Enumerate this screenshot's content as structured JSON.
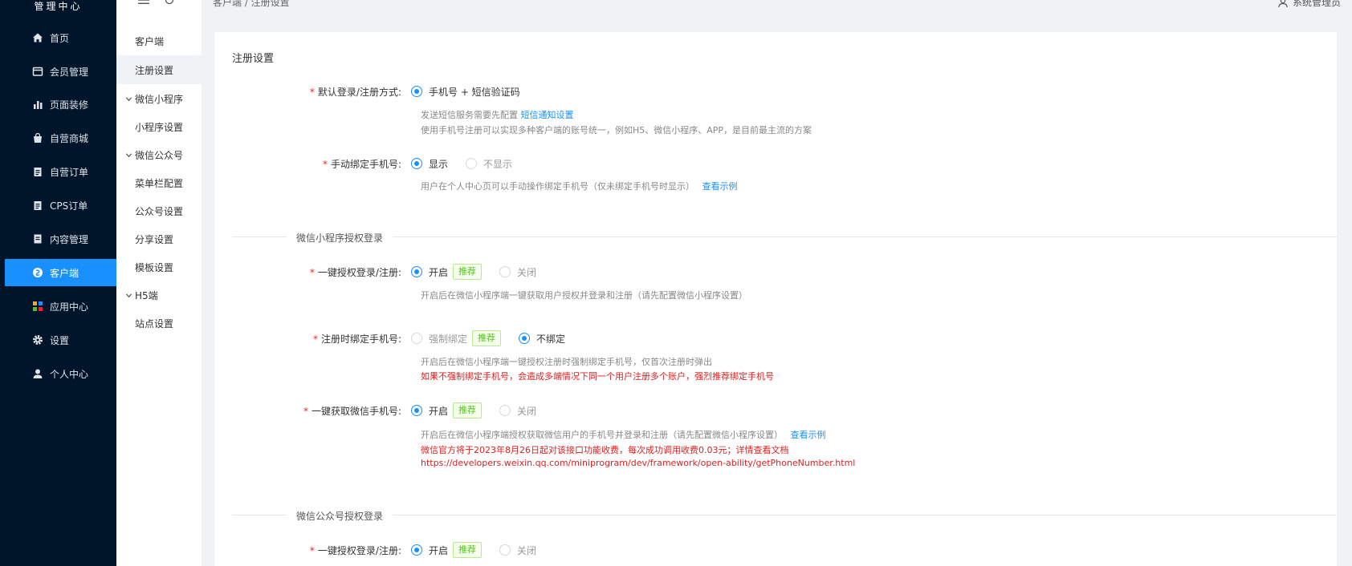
{
  "sidebar": {
    "brand": "管理中心",
    "items": [
      {
        "label": "首页",
        "icon": "home-icon"
      },
      {
        "label": "会员管理",
        "icon": "member-icon"
      },
      {
        "label": "页面装修",
        "icon": "bar-chart-icon"
      },
      {
        "label": "自营商城",
        "icon": "shopping-bag-icon"
      },
      {
        "label": "自营订单",
        "icon": "clipboard-icon"
      },
      {
        "label": "CPS订单",
        "icon": "clipboard-icon"
      },
      {
        "label": "内容管理",
        "icon": "document-icon"
      },
      {
        "label": "客户端",
        "icon": "client-icon"
      },
      {
        "label": "应用中心",
        "icon": "apps-icon"
      },
      {
        "label": "设置",
        "icon": "gear-icon"
      },
      {
        "label": "个人中心",
        "icon": "user-icon"
      }
    ],
    "active_color": "#1890ff"
  },
  "subnav": {
    "item_kehuduan": "客户端",
    "item_zhuce": "注册设置",
    "group_mini": "微信小程序",
    "item_mini_settings": "小程序设置",
    "group_mp": "微信公众号",
    "item_menu": "菜单栏配置",
    "item_mp_settings": "公众号设置",
    "item_share": "分享设置",
    "item_template": "模板设置",
    "group_h5": "H5端",
    "item_site": "站点设置"
  },
  "header": {
    "breadcrumb": "客户端 / 注册设置",
    "user": "系统管理员"
  },
  "panel": {
    "title": "注册设置",
    "login_method": {
      "label": "默认登录/注册方式:",
      "option": "手机号 + 短信验证码",
      "help1_prefix": "发送短信服务需要先配置",
      "help1_link": "短信通知设置",
      "help2": "使用手机号注册可以实现多种客户端的账号统一，例如H5、微信小程序、APP，是目前最主流的方案"
    },
    "manual_bind": {
      "label": "手动绑定手机号:",
      "opt_show": "显示",
      "opt_hide": "不显示",
      "help": "用户在个人中心页可以手动操作绑定手机号（仅未绑定手机号时显示）",
      "help_link": "查看示例"
    },
    "section_mini": "微信小程序授权登录",
    "mini_oneclick": {
      "label": "一键授权登录/注册:",
      "opt_on": "开启",
      "tag": "推荐",
      "opt_off": "关闭",
      "help": "开启后在微信小程序端一键获取用户授权并登录和注册（请先配置微信小程序设置）"
    },
    "mini_bind": {
      "label": "注册时绑定手机号:",
      "opt_force": "强制绑定",
      "tag": "推荐",
      "opt_none": "不绑定",
      "help": "开启后在微信小程序端一键授权注册时强制绑定手机号，仅首次注册时弹出",
      "warn": "如果不强制绑定手机号，会造成多端情况下同一个用户注册多个账户，强烈推荐绑定手机号"
    },
    "mini_phone": {
      "label": "一键获取微信手机号:",
      "opt_on": "开启",
      "tag": "推荐",
      "opt_off": "关闭",
      "help": "开启后在微信小程序端授权获取微信用户的手机号并登录和注册（请先配置微信小程序设置）",
      "help_link": "查看示例",
      "warn1": "微信官方将于2023年8月26日起对该接口功能收费，每次成功调用收费0.03元；详情查看文档",
      "warn2": "https://developers.weixin.qq.com/miniprogram/dev/framework/open-ability/getPhoneNumber.html"
    },
    "section_mp": "微信公众号授权登录",
    "mp_oneclick": {
      "label": "一键授权登录/注册:",
      "opt_on": "开启",
      "tag": "推荐",
      "opt_off": "关闭"
    }
  },
  "colors": {
    "sidebar_bg": "#001529",
    "primary": "#1890ff",
    "required": "#f5222d",
    "warning": "#e02020",
    "tag_green": "#52c41a"
  }
}
